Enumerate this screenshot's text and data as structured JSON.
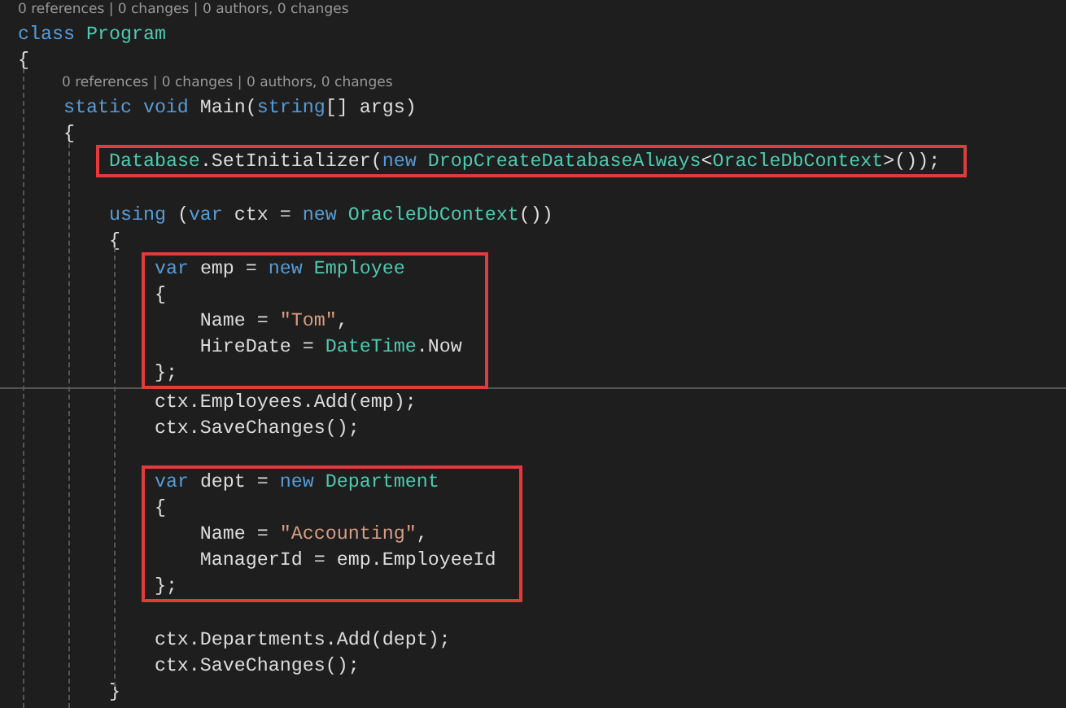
{
  "code": [
    {
      "kind": "codelens",
      "text": "0 references | 0 changes | 0 authors, 0 changes"
    },
    {
      "kind": "line",
      "tokens": [
        {
          "text": "class ",
          "kind": "keyword"
        },
        {
          "text": "Program",
          "kind": "type"
        }
      ]
    },
    {
      "kind": "line",
      "tokens": [
        {
          "text": "{",
          "kind": "plain"
        }
      ]
    },
    {
      "kind": "member-codelens",
      "text": "0 references | 0 changes | 0 authors, 0 changes"
    },
    {
      "kind": "line",
      "tokens": [
        {
          "text": "    static void ",
          "kind": "keyword"
        },
        {
          "text": "Main(",
          "kind": "plain"
        },
        {
          "text": "string",
          "kind": "keyword"
        },
        {
          "text": "[] args)",
          "kind": "plain"
        }
      ]
    },
    {
      "kind": "line",
      "tokens": [
        {
          "text": "    {",
          "kind": "plain"
        }
      ]
    },
    {
      "kind": "highlight",
      "lines": [
        {
          "tokens": [
            {
              "text": "        Database",
              "kind": "type"
            },
            {
              "text": ".SetInitializer(",
              "kind": "plain"
            },
            {
              "text": "new ",
              "kind": "keyword"
            },
            {
              "text": "DropCreateDatabaseAlways",
              "kind": "type"
            },
            {
              "text": "<",
              "kind": "plain"
            },
            {
              "text": "OracleDbContext",
              "kind": "type"
            },
            {
              "text": ">());",
              "kind": "plain"
            }
          ]
        }
      ]
    },
    {
      "kind": "blank"
    },
    {
      "kind": "line",
      "tokens": [
        {
          "text": "        using ",
          "kind": "keyword"
        },
        {
          "text": "(",
          "kind": "plain"
        },
        {
          "text": "var ",
          "kind": "keyword"
        },
        {
          "text": "ctx = ",
          "kind": "plain"
        },
        {
          "text": "new ",
          "kind": "keyword"
        },
        {
          "text": "OracleDbContext",
          "kind": "type"
        },
        {
          "text": "())",
          "kind": "plain"
        }
      ]
    },
    {
      "kind": "line",
      "tokens": [
        {
          "text": "        {",
          "kind": "plain"
        }
      ]
    },
    {
      "kind": "highlight",
      "lines": [
        {
          "tokens": [
            {
              "text": "            var ",
              "kind": "keyword"
            },
            {
              "text": "emp = ",
              "kind": "plain"
            },
            {
              "text": "new ",
              "kind": "keyword"
            },
            {
              "text": "Employee",
              "kind": "type"
            }
          ]
        },
        {
          "tokens": [
            {
              "text": "            {",
              "kind": "plain"
            }
          ]
        },
        {
          "tokens": [
            {
              "text": "                Name = ",
              "kind": "plain"
            },
            {
              "text": "\"Tom\"",
              "kind": "string"
            },
            {
              "text": ",",
              "kind": "plain"
            }
          ]
        },
        {
          "tokens": [
            {
              "text": "                HireDate = ",
              "kind": "plain"
            },
            {
              "text": "DateTime",
              "kind": "type"
            },
            {
              "text": ".Now",
              "kind": "plain"
            }
          ]
        },
        {
          "tokens": [
            {
              "text": "            };",
              "kind": "plain"
            }
          ]
        }
      ]
    },
    {
      "kind": "rule"
    },
    {
      "kind": "line",
      "tokens": [
        {
          "text": "            ctx.Employees.Add(emp);",
          "kind": "plain"
        }
      ]
    },
    {
      "kind": "line",
      "tokens": [
        {
          "text": "            ctx.SaveChanges();",
          "kind": "plain"
        }
      ]
    },
    {
      "kind": "blank"
    },
    {
      "kind": "highlight",
      "lines": [
        {
          "tokens": [
            {
              "text": "            var ",
              "kind": "keyword"
            },
            {
              "text": "dept = ",
              "kind": "plain"
            },
            {
              "text": "new ",
              "kind": "keyword"
            },
            {
              "text": "Department",
              "kind": "type"
            }
          ]
        },
        {
          "tokens": [
            {
              "text": "            {",
              "kind": "plain"
            }
          ]
        },
        {
          "tokens": [
            {
              "text": "                Name = ",
              "kind": "plain"
            },
            {
              "text": "\"Accounting\"",
              "kind": "string"
            },
            {
              "text": ",",
              "kind": "plain"
            }
          ]
        },
        {
          "tokens": [
            {
              "text": "                ManagerId = emp.EmployeeId",
              "kind": "plain"
            }
          ]
        },
        {
          "tokens": [
            {
              "text": "            };",
              "kind": "plain"
            }
          ]
        }
      ]
    },
    {
      "kind": "blank"
    },
    {
      "kind": "line",
      "tokens": [
        {
          "text": "            ctx.Departments.Add(dept);",
          "kind": "plain"
        }
      ]
    },
    {
      "kind": "line",
      "tokens": [
        {
          "text": "            ctx.SaveChanges();",
          "kind": "plain"
        }
      ]
    },
    {
      "kind": "line",
      "tokens": [
        {
          "text": "        }",
          "kind": "plain"
        }
      ]
    }
  ]
}
